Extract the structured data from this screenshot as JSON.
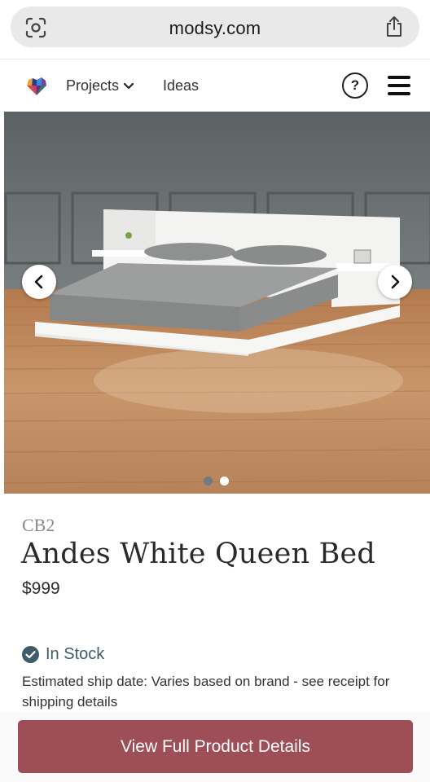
{
  "browser": {
    "url": "modsy.com",
    "icons": {
      "left": "lens-icon",
      "right": "share-icon"
    }
  },
  "nav": {
    "logo": "modsy-heart-logo",
    "projects_label": "Projects",
    "ideas_label": "Ideas",
    "help_label": "?",
    "icons": [
      "chevron-down-icon",
      "help-icon",
      "hamburger-menu-icon"
    ]
  },
  "carousel": {
    "slide_count": 2,
    "active_index": 1,
    "image_subject": "white platform bed",
    "icons": [
      "chevron-left-icon",
      "chevron-right-icon"
    ]
  },
  "product": {
    "brand": "CB2",
    "title": "Andes White Queen Bed",
    "price": "$999",
    "stock_status": "In Stock",
    "ship_note": "Estimated ship date: Varies based on brand - see receipt for shipping details"
  },
  "cta": {
    "label": "View Full Product Details"
  },
  "colors": {
    "cta_background": "#9e4e57",
    "stock_text": "#3f5c6a",
    "brand_text": "#8a8a8a"
  }
}
